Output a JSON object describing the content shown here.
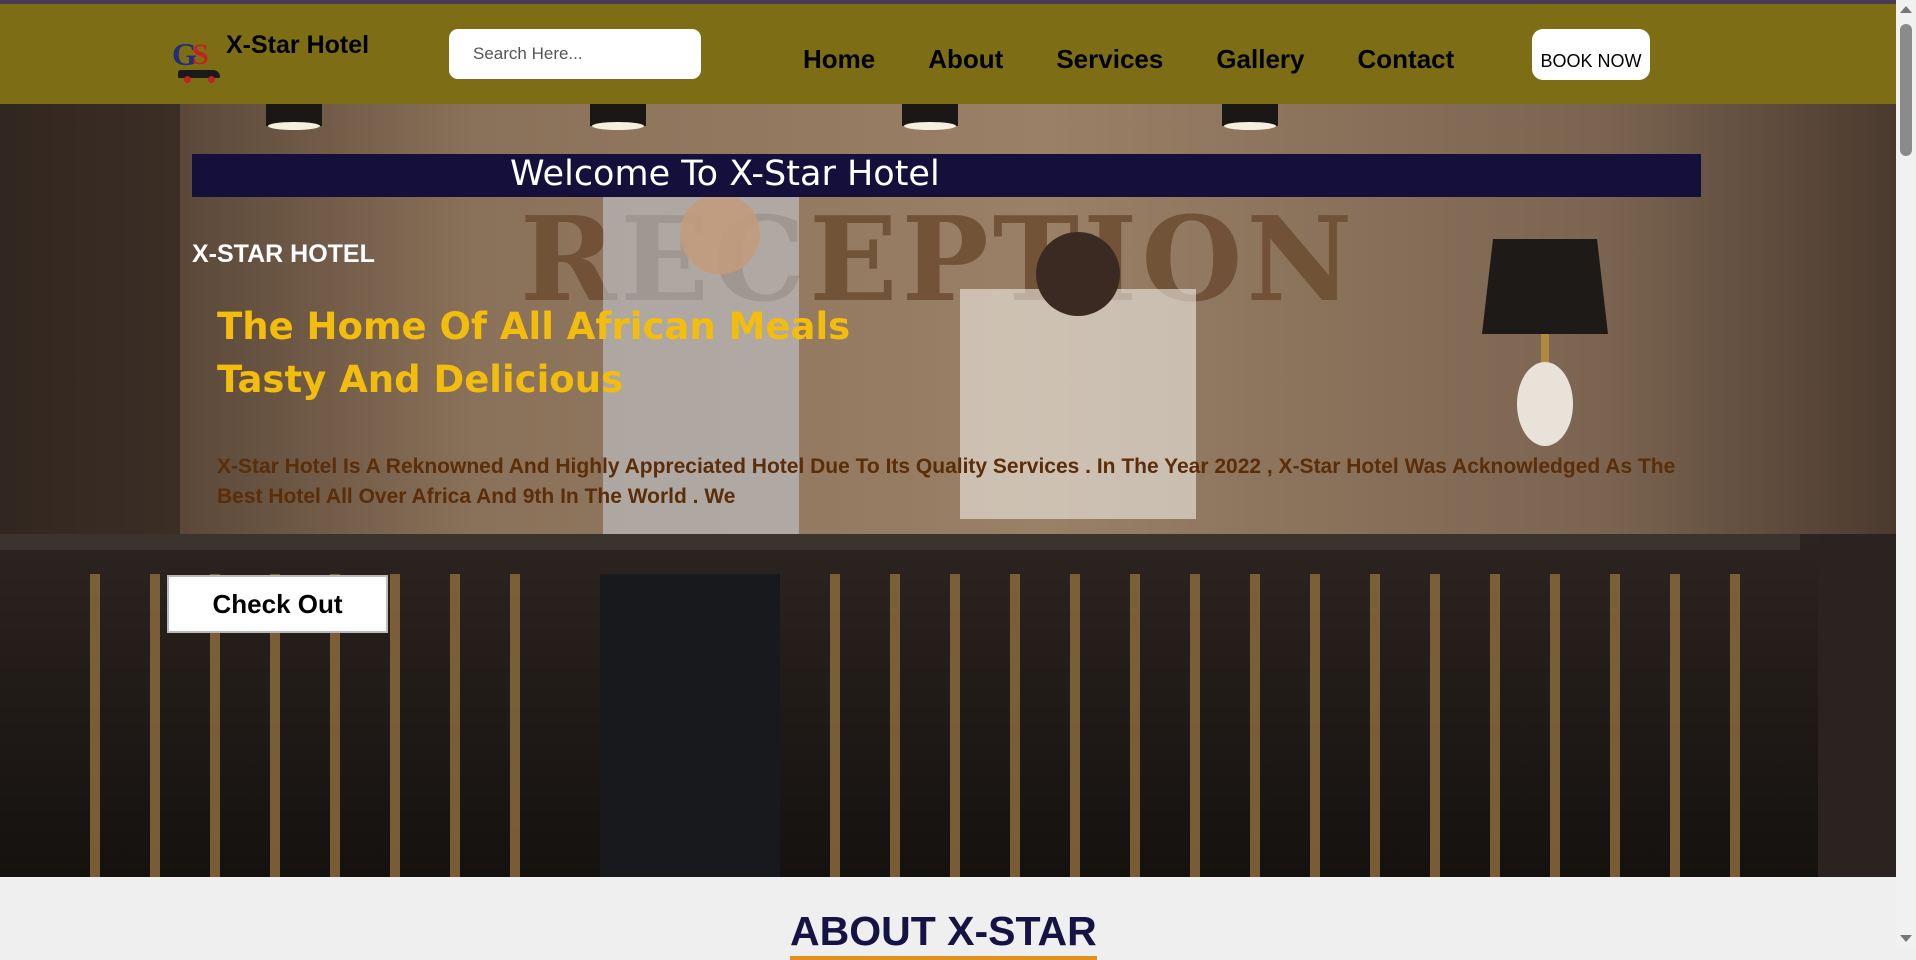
{
  "header": {
    "brand_name": "X-Star Hotel",
    "logo_letters": "GS",
    "search_placeholder": "Search Here...",
    "nav": [
      "Home",
      "About",
      "Services",
      "Gallery",
      "Contact"
    ],
    "book_label": "BOOK NOW"
  },
  "hero": {
    "welcome": "Welcome To X-Star Hotel",
    "reception_sign": "RECEPTION",
    "kicker": "X-STAR HOTEL",
    "headline": "The Home Of All African Meals Tasty And Delicious",
    "intro": "X-Star Hotel Is A Reknowned And Highly Appreciated Hotel Due To Its Quality Services . In The Year 2022 , X-Star Hotel Was Acknowledged As The Best Hotel All Over Africa And 9th In The World . We",
    "cta_label": "Check Out"
  },
  "about": {
    "title": "ABOUT X-STAR"
  },
  "colors": {
    "header_bg": "#7d6d14",
    "welcome_bar": "#150f3c",
    "headline": "#f2bd0c",
    "intro_text": "#5a2e08",
    "about_title": "#141344",
    "about_underline": "#e4901c"
  }
}
